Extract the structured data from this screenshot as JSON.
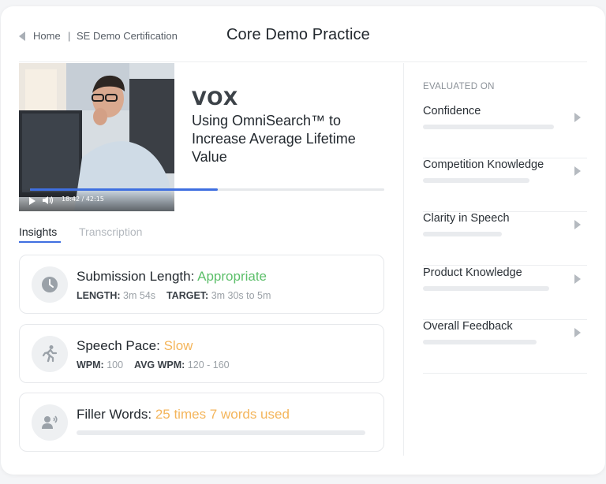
{
  "breadcrumb": {
    "home": "Home",
    "separator": "|",
    "current": "SE Demo Certification"
  },
  "page_title": "Core Demo Practice",
  "video": {
    "brand": "VOX",
    "title": "Using OmniSearch™ to Increase Average Lifetime Value",
    "time": "18:42 / 42:15",
    "progress": 0.53,
    "icons": [
      "play-icon",
      "volume-icon"
    ]
  },
  "tabs": [
    {
      "label": "Insights",
      "active": true
    },
    {
      "label": "Transcription",
      "active": false
    }
  ],
  "insights": {
    "submission": {
      "icon": "clock-icon",
      "label": "Submission Length:",
      "status": "Appropriate",
      "length_label": "LENGTH:",
      "length_value": "3m 54s",
      "target_label": "TARGET:",
      "target_value": "3m 30s to 5m"
    },
    "pace": {
      "icon": "running-person-icon",
      "label": "Speech Pace:",
      "status": "Slow",
      "wpm_label": "WPM:",
      "wpm_value": "100",
      "avg_label": "AVG WPM:",
      "avg_value": "120 - 160"
    },
    "filler": {
      "icon": "speaker-person-icon",
      "label": "Filler Words:",
      "status": "25 times 7 words used"
    }
  },
  "evaluated": {
    "heading": "EVALUATED ON",
    "items": [
      {
        "label": "Confidence",
        "fill": 0.8
      },
      {
        "label": "Competition Knowledge",
        "fill": 0.65
      },
      {
        "label": "Clarity in Speech",
        "fill": 0.48
      },
      {
        "label": "Product Knowledge",
        "fill": 0.77
      },
      {
        "label": "Overall Feedback",
        "fill": 0.69
      }
    ]
  },
  "colors": {
    "accent": "#3f6fe0",
    "status_good": "#5cbf6a",
    "status_warn": "#f4b55b"
  }
}
